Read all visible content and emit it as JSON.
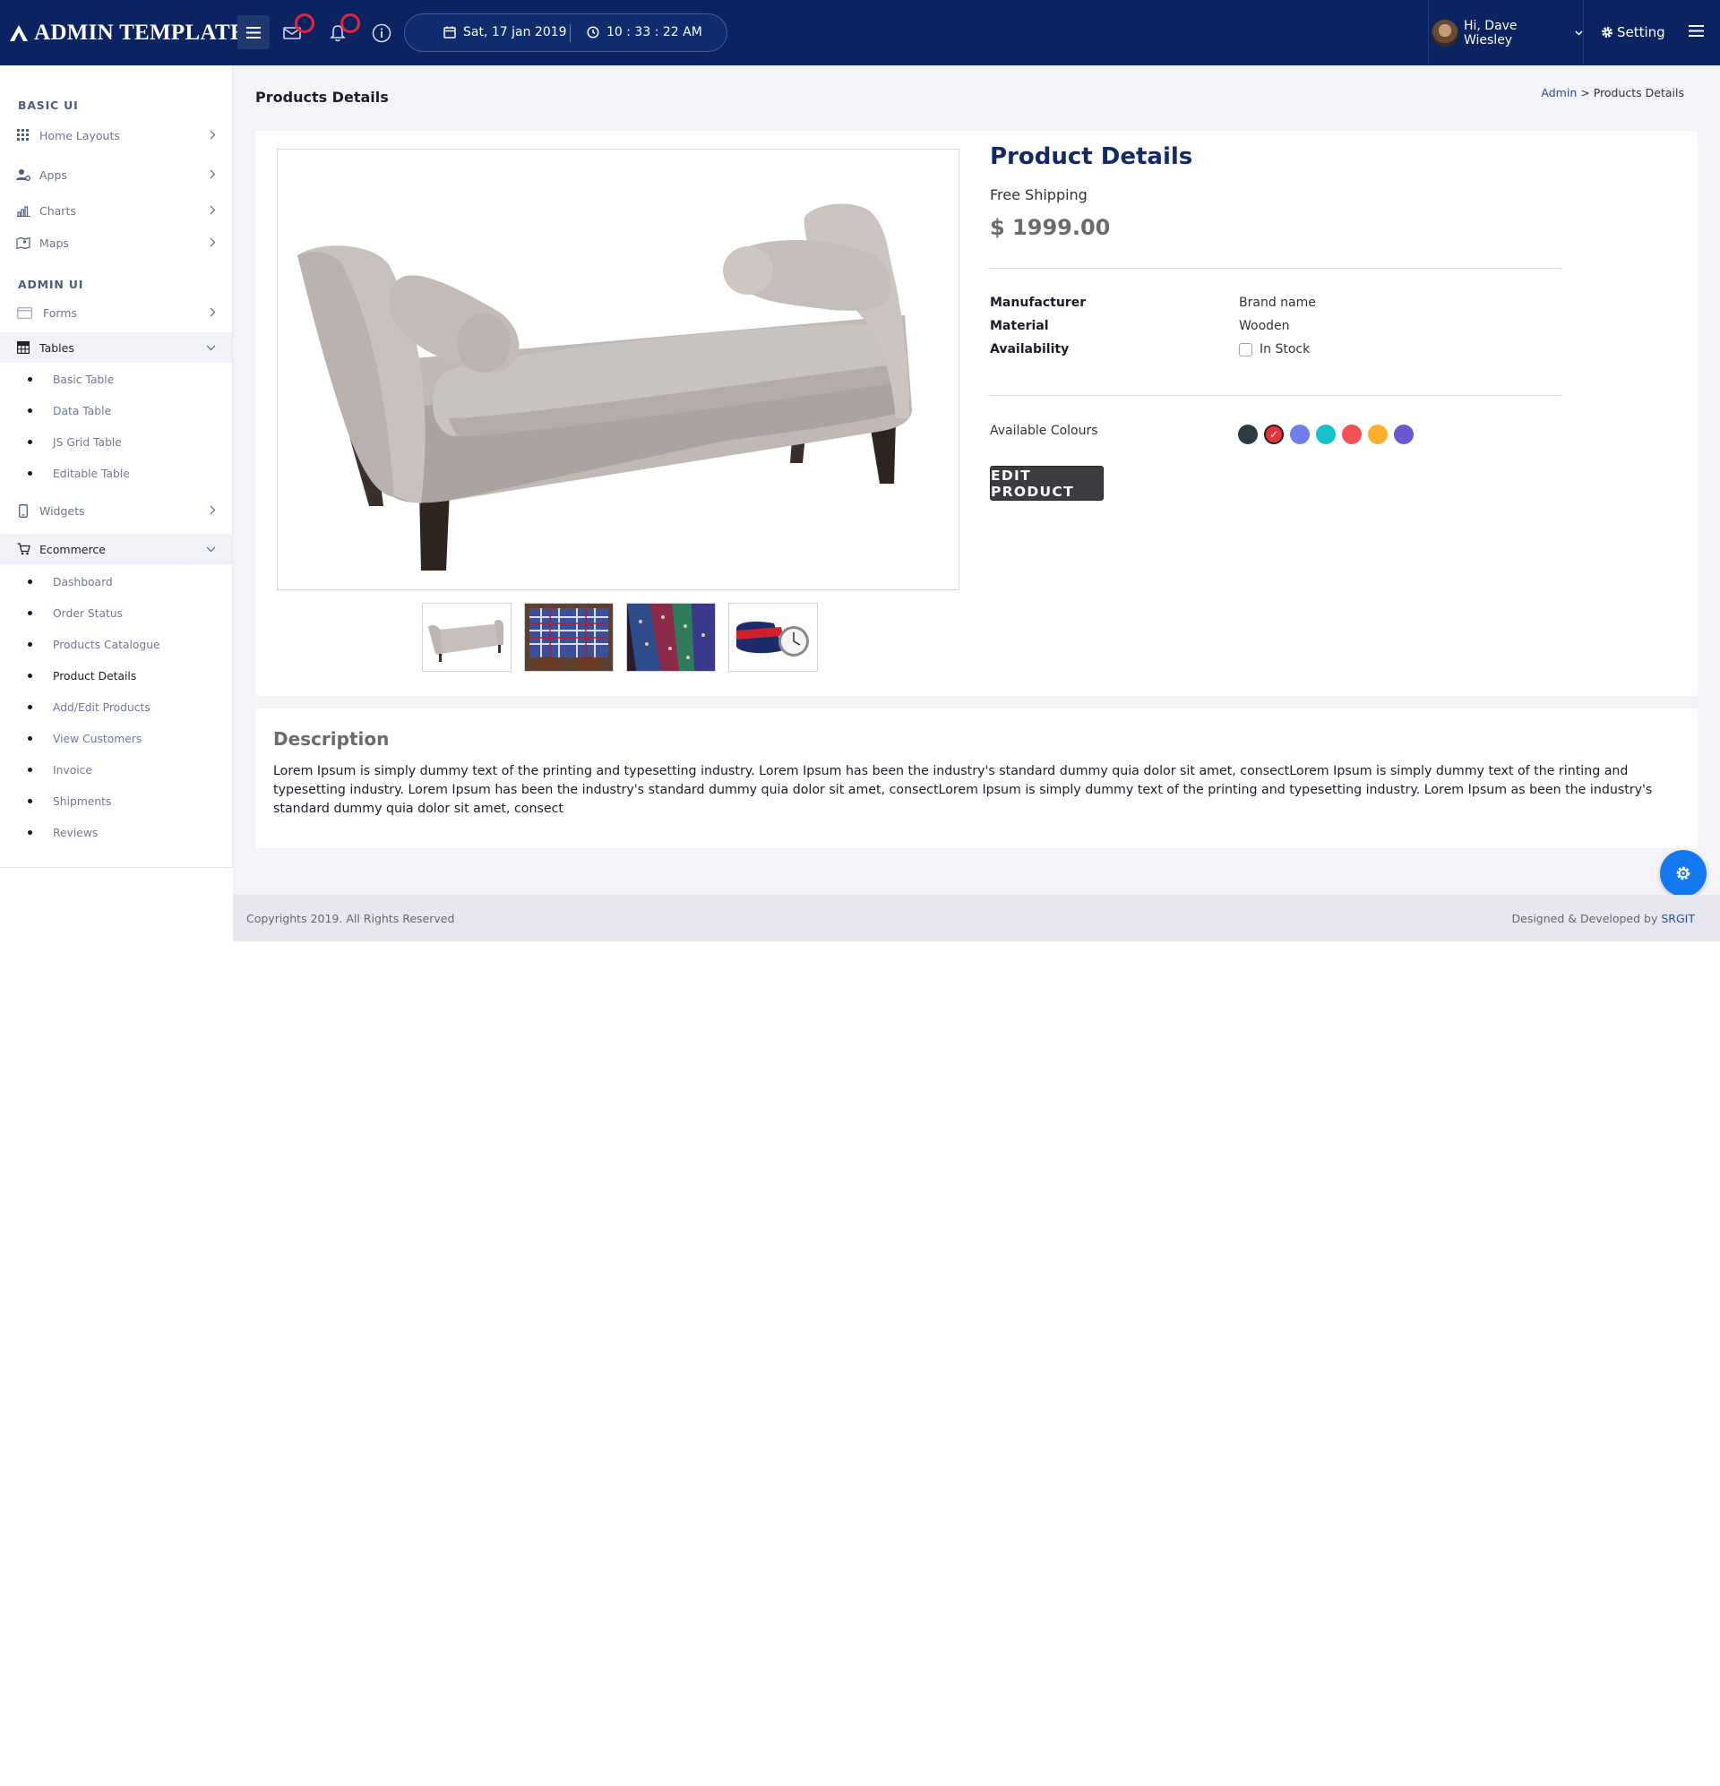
{
  "header": {
    "logo_text": "ADMIN TEMPLATE",
    "date": "Sat, 17 jan 2019",
    "time": "10 : 33 : 22 AM",
    "user_greeting": "Hi, Dave Wiesley",
    "setting_label": "Setting"
  },
  "sidebar": {
    "section_basic": "BASIC UI",
    "section_admin": "ADMIN UI",
    "home_layouts": "Home Layouts",
    "apps": "Apps",
    "charts": "Charts",
    "maps": "Maps",
    "forms": "Forms",
    "tables": "Tables",
    "tables_sub": [
      "Basic Table",
      "Data Table",
      "JS Grid Table",
      "Editable Table"
    ],
    "widgets": "Widgets",
    "ecommerce": "Ecommerce",
    "ecommerce_sub": [
      "Dashboard",
      "Order Status",
      "Products Catalogue",
      "Product Details",
      "Add/Edit Products",
      "View Customers",
      "Invoice",
      "Shipments",
      "Reviews"
    ],
    "active_item": "Product Details"
  },
  "page": {
    "title": "Products Details",
    "breadcrumb_link": "Admin",
    "breadcrumb_sep": ">",
    "breadcrumb_current": "Products Details"
  },
  "product": {
    "title": "Product Details",
    "shipping": "Free Shipping",
    "price": "$ 1999.00",
    "specs": {
      "manufacturer_label": "Manufacturer",
      "manufacturer_value": "Brand name",
      "material_label": "Material",
      "material_value": "Wooden",
      "availability_label": "Availability",
      "availability_value": "In Stock"
    },
    "in_stock_checked": false,
    "colours_label": "Available Colours",
    "colours": [
      "#2b3a44",
      "#e8333c",
      "#6f7ee8",
      "#17c1cc",
      "#f1525a",
      "#fbb12b",
      "#6c57d1"
    ],
    "selected_colour": "#e8333c",
    "edit_button": "EDIT PRODUCT",
    "thumbnails": [
      "sofa-thumbnail",
      "shirt-thumbnail",
      "ties-thumbnail",
      "watch-thumbnail"
    ]
  },
  "description": {
    "title": "Description",
    "text": "Lorem Ipsum is simply dummy text of the printing and typesetting industry. Lorem Ipsum has been the industry's standard dummy quia dolor sit amet, consectLorem Ipsum is simply dummy text of the rinting and typesetting industry. Lorem Ipsum has been the industry's standard dummy quia dolor sit amet, consectLorem Ipsum is simply dummy text of the printing and typesetting industry. Lorem Ipsum as been the industry's standard dummy quia dolor sit amet, consect"
  },
  "footer": {
    "copyright": "Copyrights 2019. All Rights Reserved",
    "credit_prefix": "Designed & Developed by",
    "credit_brand": "SRGIT"
  },
  "colors": {
    "topbar": "#0b2360",
    "title_navy": "#102a6b",
    "fab_blue": "#1479f0",
    "badge_red": "#e8233c"
  }
}
